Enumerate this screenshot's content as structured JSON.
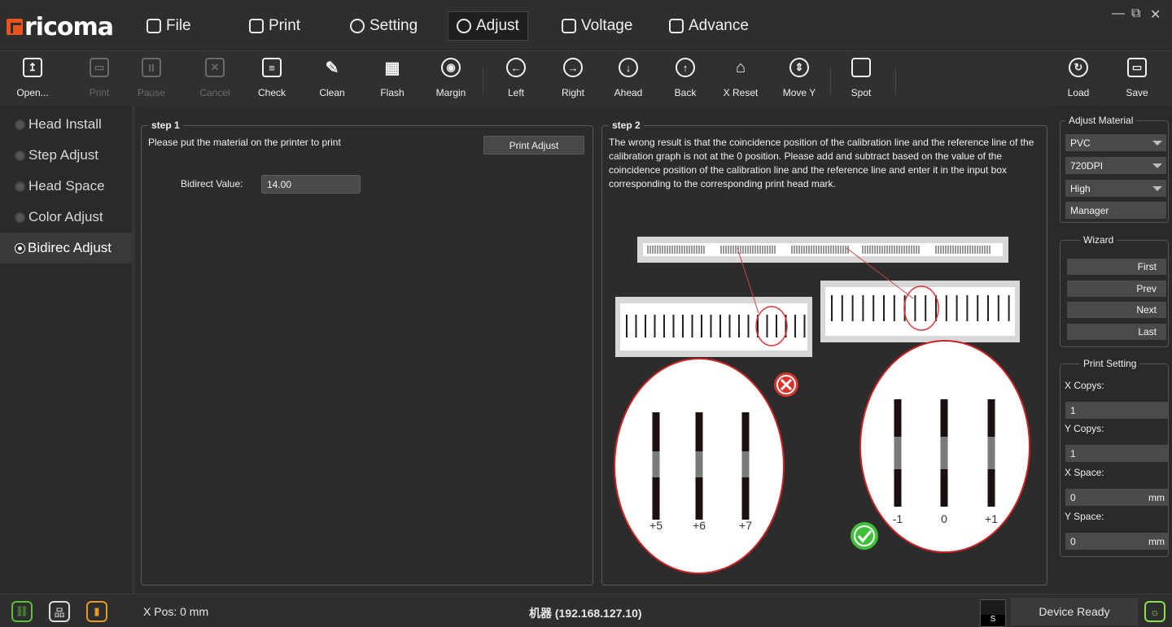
{
  "app": {
    "logo": "ricoma"
  },
  "menu": {
    "file": "File",
    "print": "Print",
    "setting": "Setting",
    "adjust": "Adjust",
    "voltage": "Voltage",
    "advance": "Advance"
  },
  "window": {
    "minimize": "—",
    "restore": "⧉",
    "close": "✕"
  },
  "toolbar": {
    "open": "Open...",
    "print": "Print",
    "pause": "Pause",
    "cancel": "Cancel",
    "check": "Check",
    "clean": "Clean",
    "flash": "Flash",
    "margin": "Margin",
    "left": "Left",
    "right": "Right",
    "ahead": "Ahead",
    "back": "Back",
    "xreset": "X Reset",
    "movey": "Move Y",
    "spot": "Spot",
    "load": "Load",
    "save": "Save"
  },
  "sidenav": {
    "items": [
      {
        "label": "Head Install"
      },
      {
        "label": "Step Adjust"
      },
      {
        "label": "Head Space"
      },
      {
        "label": "Color Adjust"
      },
      {
        "label": "Bidirec Adjust"
      }
    ]
  },
  "step1": {
    "title": "step 1",
    "instruction": "Please put the material on the printer to print",
    "print_adjust_button": "Print Adjust",
    "bidirect_label": "Bidirect Value:",
    "bidirect_value": "14.00"
  },
  "step2": {
    "title": "step 2",
    "text": "The wrong result is that the coincidence position of the calibration line and the reference line of the calibration graph is not at the 0 position. Please add and subtract based on the value of the coincidence position of the calibration line and the reference line and enter it in the input box corresponding to the corresponding print head mark.",
    "wrong_labels": [
      "+5",
      "+6",
      "+7"
    ],
    "right_labels": [
      "-1",
      "0",
      "+1"
    ]
  },
  "right_panel": {
    "adjust_material_title": "Adjust Material",
    "material": "PVC",
    "resolution": "720DPI",
    "quality": "High",
    "manager_button": "Manager",
    "wizard_title": "Wizard",
    "first": "First",
    "prev": "Prev",
    "next": "Next",
    "last": "Last",
    "print_setting_title": "Print Setting",
    "x_copys_label": "X Copys:",
    "x_copys_value": "1",
    "y_copys_label": "Y Copys:",
    "y_copys_value": "1",
    "x_space_label": "X Space:",
    "x_space_value": "0",
    "y_space_label": "Y Space:",
    "y_space_value": "0",
    "unit": "mm"
  },
  "status": {
    "xpos": "X Pos: 0 mm",
    "device": "机器 (192.168.127.10)",
    "ink_letter": "S",
    "ready": "Device Ready"
  },
  "colors": {
    "accent_orange": "#e8541c",
    "icon_green": "#5fbf3a",
    "icon_orange": "#e89a2a",
    "error_red": "#d9342b",
    "ok_green": "#3fbf3a"
  }
}
